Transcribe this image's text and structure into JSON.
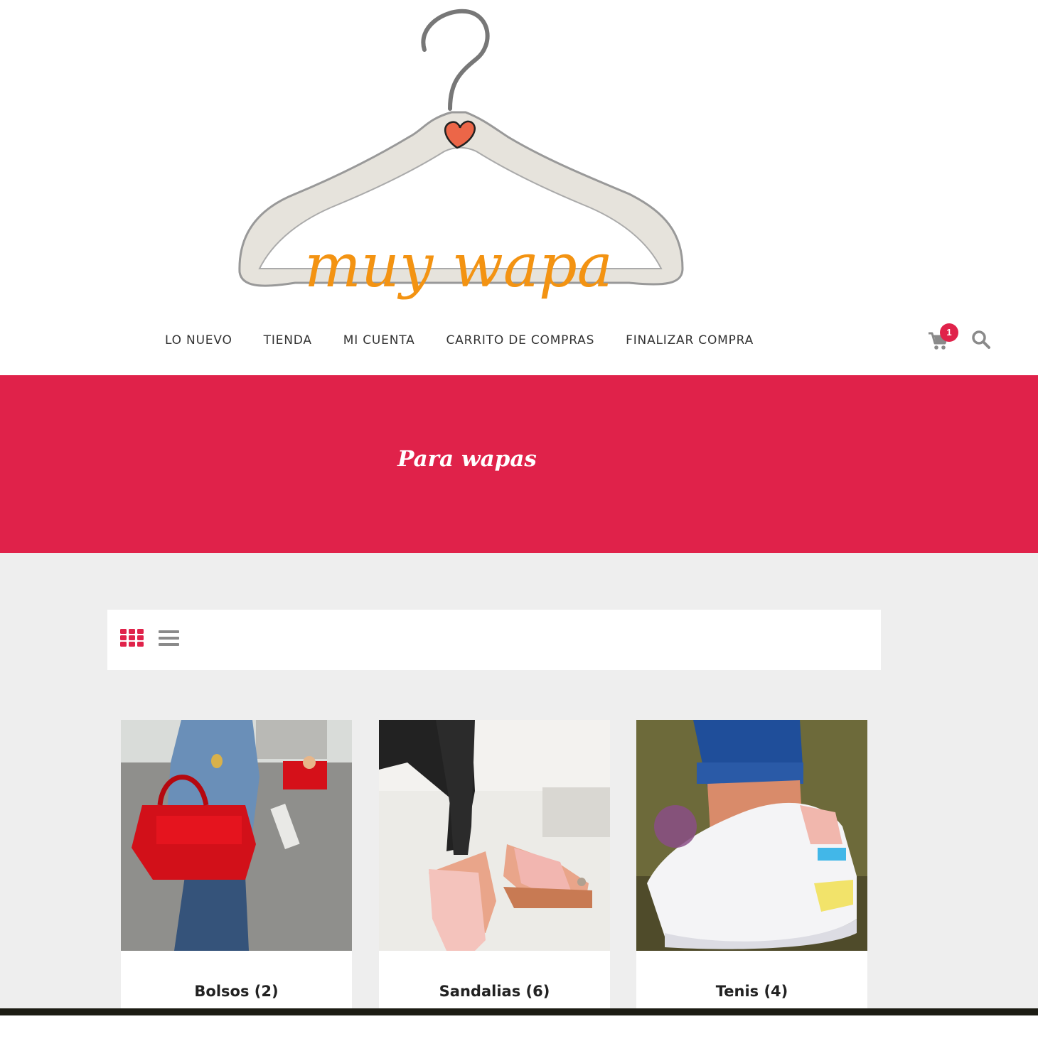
{
  "brand": {
    "logo_text": "muy wapa"
  },
  "nav": {
    "items": [
      {
        "label": "LO NUEVO"
      },
      {
        "label": "TIENDA"
      },
      {
        "label": "MI CUENTA"
      },
      {
        "label": "CARRITO DE COMPRAS"
      },
      {
        "label": "FINALIZAR COMPRA"
      }
    ]
  },
  "cart": {
    "count": "1",
    "icon": "cart-icon"
  },
  "search": {
    "icon": "search-icon"
  },
  "hero": {
    "title": "Para wapas"
  },
  "colors": {
    "accent": "#e0224a",
    "logo_orange": "#f39312",
    "background": "#eeeeee"
  },
  "view_toggle": {
    "grid_icon": "grid-view-icon",
    "list_icon": "list-view-icon",
    "active": "grid"
  },
  "categories": [
    {
      "name": "Bolsos",
      "count": "(2)",
      "label": "Bolsos  (2)"
    },
    {
      "name": "Sandalias",
      "count": "(6)",
      "label": "Sandalias  (6)"
    },
    {
      "name": "Tenis",
      "count": "(4)",
      "label": "Tenis  (4)"
    }
  ]
}
